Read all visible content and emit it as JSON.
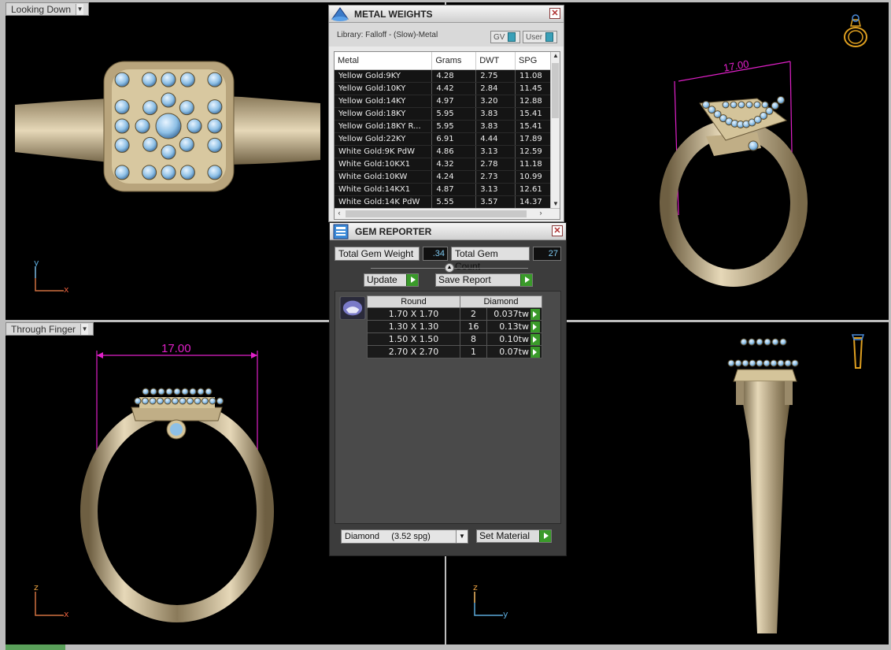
{
  "viewports": {
    "top_left": {
      "label": "Looking Down",
      "axis_v": "y",
      "axis_h": "x",
      "dimension": ""
    },
    "top_right": {
      "label": "",
      "axis_v": "",
      "axis_h": "",
      "dimension": "17.00"
    },
    "bottom_left": {
      "label": "Through Finger",
      "axis_v": "z",
      "axis_h": "x",
      "dimension": "17.00"
    },
    "bottom_right": {
      "label": "",
      "axis_v": "z",
      "axis_h": "y",
      "dimension": ""
    }
  },
  "metal_weights": {
    "title": "METAL WEIGHTS",
    "library": "Library: Falloff - (Slow)-Metal",
    "toggle_gv": "GV",
    "toggle_user": "User",
    "columns": [
      "Metal",
      "Grams",
      "DWT",
      "SPG"
    ],
    "rows": [
      [
        "Yellow Gold:9KY",
        "4.28",
        "2.75",
        "11.08"
      ],
      [
        "Yellow Gold:10KY",
        "4.42",
        "2.84",
        "11.45"
      ],
      [
        "Yellow Gold:14KY",
        "4.97",
        "3.20",
        "12.88"
      ],
      [
        "Yellow Gold:18KY",
        "5.95",
        "3.83",
        "15.41"
      ],
      [
        "Yellow Gold:18KY R...",
        "5.95",
        "3.83",
        "15.41"
      ],
      [
        "Yellow Gold:22KY",
        "6.91",
        "4.44",
        "17.89"
      ],
      [
        "White Gold:9K PdW",
        "4.86",
        "3.13",
        "12.59"
      ],
      [
        "White Gold:10KX1",
        "4.32",
        "2.78",
        "11.18"
      ],
      [
        "White Gold:10KW",
        "4.24",
        "2.73",
        "10.99"
      ],
      [
        "White Gold:14KX1",
        "4.87",
        "3.13",
        "12.61"
      ],
      [
        "White Gold:14K PdW",
        "5.55",
        "3.57",
        "14.37"
      ]
    ]
  },
  "gem_reporter": {
    "title": "GEM REPORTER",
    "total_weight_label": "Total Gem Weight",
    "total_weight_value": ".34",
    "total_count_label": "Total Gem Count",
    "total_count_value": "27",
    "update_label": "Update",
    "save_report_label": "Save Report",
    "columns": [
      "Round",
      "Diamond"
    ],
    "rows": [
      {
        "size": "1.70 X 1.70",
        "count": "2",
        "weight": "0.037tw"
      },
      {
        "size": "1.30 X 1.30",
        "count": "16",
        "weight": "0.13tw"
      },
      {
        "size": "1.50 X 1.50",
        "count": "8",
        "weight": "0.10tw"
      },
      {
        "size": "2.70 X 2.70",
        "count": "1",
        "weight": "0.07tw"
      }
    ],
    "material_select": "Diamond     (3.52 spg)",
    "set_material_label": "Set Material"
  },
  "colors": {
    "metal": "#c8b896",
    "gem": "#8ec0e6",
    "dimension": "#e020c8"
  },
  "icons": [
    "ring-orientation-icon",
    "ring-side-icon",
    "metal-weights-logo",
    "gem-reporter-logo",
    "round-gem-icon"
  ]
}
